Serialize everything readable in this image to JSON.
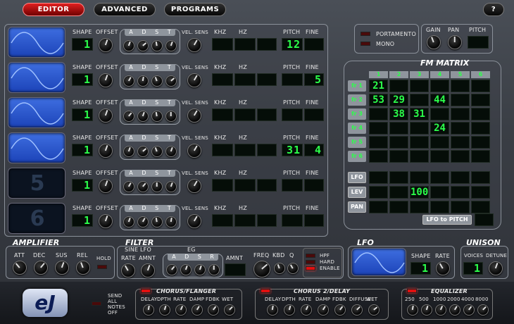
{
  "top_tabs": {
    "editor": "EDITOR",
    "advanced": "ADVANCED",
    "programs": "PROGRAMS",
    "help": "?"
  },
  "osc_labels": {
    "shape": "SHAPE",
    "offset": "OFFSET",
    "a": "A",
    "d": "D",
    "s": "S",
    "t": "T",
    "vel": "VEL. SENS",
    "khz": "KHZ",
    "hz": "HZ",
    "pitch": "PITCH",
    "fine": "FINE"
  },
  "oscillators": [
    {
      "active": true,
      "number": "1",
      "shape": "1",
      "pitch": "12",
      "fine": ""
    },
    {
      "active": true,
      "number": "2",
      "shape": "1",
      "pitch": "",
      "fine": "5"
    },
    {
      "active": true,
      "number": "3",
      "shape": "1",
      "pitch": "",
      "fine": ""
    },
    {
      "active": true,
      "number": "4",
      "shape": "1",
      "pitch": "31",
      "fine": "4"
    },
    {
      "active": false,
      "number": "5",
      "shape": "1",
      "pitch": "",
      "fine": ""
    },
    {
      "active": false,
      "number": "6",
      "shape": "1",
      "pitch": "",
      "fine": ""
    }
  ],
  "global": {
    "portamento": "PORTAMENTO",
    "mono": "MONO",
    "gain": "GAIN",
    "pan": "PAN",
    "pitch": "PITCH"
  },
  "fm": {
    "title": "FM MATRIX",
    "cols": [
      "1",
      "2",
      "3",
      "4",
      "5",
      "6"
    ],
    "rows": [
      "fr 1",
      "fr 2",
      "fr 3",
      "fr 4",
      "fr 5",
      "fr 6"
    ],
    "values": [
      [
        "21",
        "",
        "",
        "",
        "",
        ""
      ],
      [
        "53",
        "29",
        "",
        "44",
        "",
        ""
      ],
      [
        "",
        "38",
        "31",
        "",
        "",
        ""
      ],
      [
        "",
        "",
        "",
        "24",
        "",
        ""
      ],
      [
        "",
        "",
        "",
        "",
        "",
        ""
      ],
      [
        "",
        "",
        "",
        "",
        "",
        ""
      ]
    ],
    "mod_rows": [
      "LFO",
      "LEV",
      "PAN"
    ],
    "mod_values": [
      [
        "",
        "",
        "",
        "",
        "",
        ""
      ],
      [
        "",
        "",
        "100",
        "",
        "",
        ""
      ],
      [
        "",
        "",
        "",
        "",
        "",
        ""
      ]
    ],
    "lfo_pitch": "LFO to PITCH"
  },
  "amplifier": {
    "title": "AMPLIFIER",
    "att": "ATT",
    "dec": "DEC",
    "sus": "SUS",
    "rel": "REL",
    "hold": "HOLD"
  },
  "filter": {
    "title": "FILTER",
    "sine_lfo": "SINE LFO",
    "rate": "RATE",
    "amnt": "AMNT",
    "eg": "EG",
    "a": "A",
    "d": "D",
    "s": "S",
    "r": "R",
    "amnt2": "AMNT",
    "freq": "FREQ",
    "kbd": "KBD",
    "q": "Q",
    "hpf": "HPF",
    "hard": "HARD",
    "enable": "ENABLE"
  },
  "lfo": {
    "title": "LFO",
    "shape": "SHAPE",
    "rate": "RATE",
    "shape_value": "1"
  },
  "unison": {
    "title": "UNISON",
    "voices": "VOICES",
    "detune": "DETUNE",
    "voices_value": "1"
  },
  "bottom": {
    "logo": "eJ",
    "send_notes_off": "SEND ALL NOTES OFF",
    "chorus_flanger": {
      "title": "CHORUS/FLANGER",
      "knobs": [
        "DELAY",
        "DPTH",
        "RATE",
        "DAMP",
        "FDBK",
        "WET"
      ]
    },
    "chorus_delay": {
      "title": "CHORUS 2/DELAY",
      "knobs": [
        "DELAY",
        "DPTH",
        "RATE",
        "DAMP",
        "FDBK",
        "DIFFUSE",
        "WET"
      ]
    },
    "equalizer": {
      "title": "EQUALIZER",
      "knobs": [
        "250",
        "500",
        "1000",
        "2000",
        "4000",
        "8000"
      ]
    }
  }
}
